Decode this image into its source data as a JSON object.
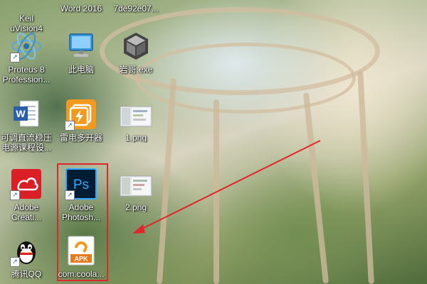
{
  "desktop": {
    "icons": [
      {
        "id": "keil",
        "label": "Keil\nuVision4",
        "icon": "keil-icon",
        "shortcut": false
      },
      {
        "id": "word2016-top",
        "label": "Word 2016",
        "icon": "word-icon",
        "shortcut": false
      },
      {
        "id": "hash-file",
        "label": "7de92e07...",
        "icon": "file-icon",
        "shortcut": false
      },
      {
        "id": "proteus",
        "label": "Proteus 8\nProfession...",
        "icon": "proteus-icon",
        "shortcut": true
      },
      {
        "id": "this-pc",
        "label": "此电脑",
        "icon": "computer-icon",
        "shortcut": false
      },
      {
        "id": "yange",
        "label": "岩哥.exe",
        "icon": "cube-icon",
        "shortcut": false
      },
      {
        "id": "word-doc",
        "label": "可调直流稳压\n电源课程设...",
        "icon": "word-document-icon",
        "shortcut": false
      },
      {
        "id": "leidian",
        "label": "雷电多开器",
        "icon": "leidian-icon",
        "shortcut": true
      },
      {
        "id": "png1",
        "label": "1.png",
        "icon": "image-thumbnail-icon",
        "shortcut": false
      },
      {
        "id": "adobe-cc",
        "label": "Adobe\nCreati...",
        "icon": "adobe-cc-icon",
        "shortcut": true
      },
      {
        "id": "photoshop",
        "label": "Adobe\nPhotosh...",
        "icon": "photoshop-icon",
        "shortcut": true
      },
      {
        "id": "png2",
        "label": "2.png",
        "icon": "image-thumbnail-icon",
        "shortcut": false
      },
      {
        "id": "qq",
        "label": "腾讯QQ",
        "icon": "qq-icon",
        "shortcut": true
      },
      {
        "id": "apk",
        "label": "com.coola...",
        "icon": "apk-icon",
        "shortcut": false
      }
    ],
    "photoshop_glyph_text": "Ps",
    "apk_glyph_text": "APK",
    "annotation_color": "#e0262b"
  }
}
